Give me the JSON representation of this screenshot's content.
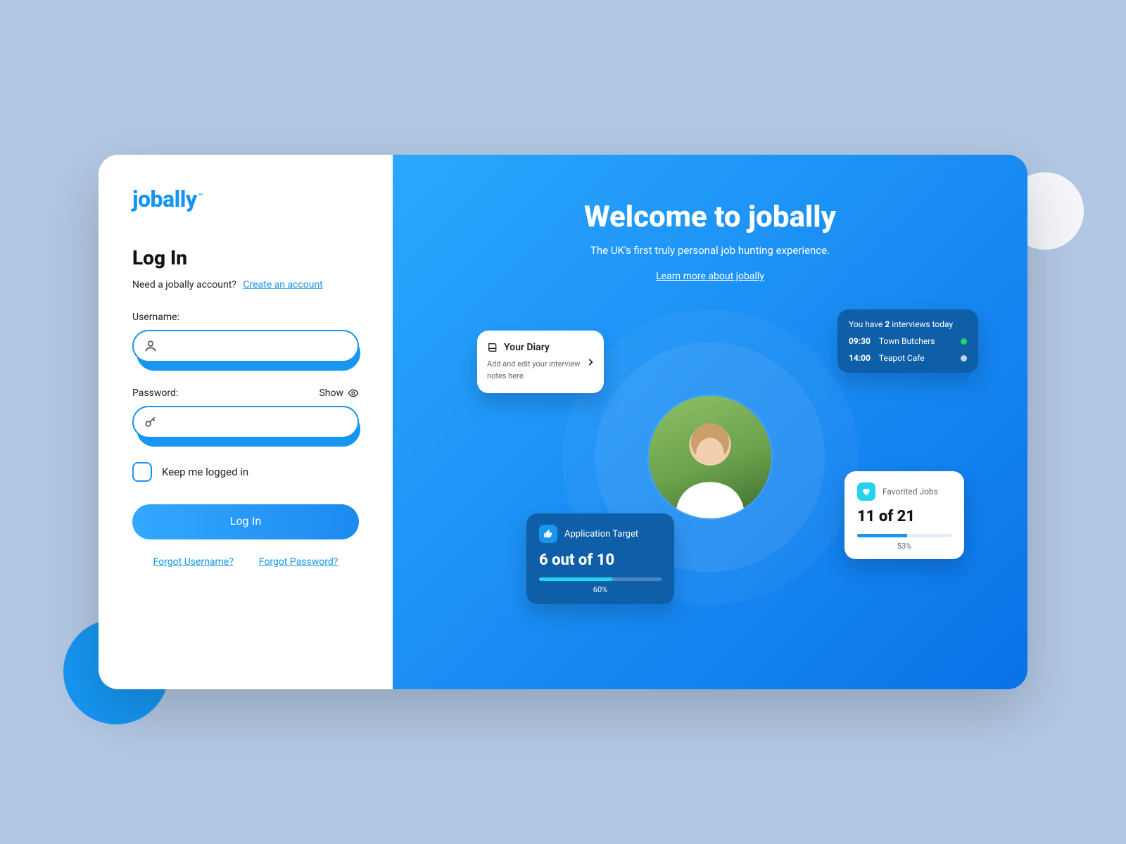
{
  "brand": {
    "name": "jobally",
    "tm": "™"
  },
  "login": {
    "heading": "Log In",
    "need_account_text": "Need a jobally account?",
    "create_account_link": "Create an account",
    "username_label": "Username:",
    "password_label": "Password:",
    "show_label": "Show",
    "remember_label": "Keep me logged in",
    "submit_label": "Log In",
    "forgot_username": "Forgot Username?",
    "forgot_password": "Forgot Password?"
  },
  "hero": {
    "title": "Welcome to jobally",
    "tagline": "The UK's first truly personal job hunting experience.",
    "learn_more": "Learn more about jobally"
  },
  "diary": {
    "title": "Your Diary",
    "subtitle": "Add and edit your interview notes here."
  },
  "interviews": {
    "heading_pre": "You have ",
    "heading_count": "2",
    "heading_post": " interviews today",
    "items": [
      {
        "time": "09:30",
        "label": "Town Butchers",
        "dot": "#26d36a"
      },
      {
        "time": "14:00",
        "label": "Teapot Cafe",
        "dot": "#c3d4e6"
      }
    ]
  },
  "application_target": {
    "title": "Application Target",
    "value": "6 out of 10",
    "percent_label": "60%",
    "percent": 60
  },
  "fav_jobs": {
    "title": "Favorited Jobs",
    "value": "11 of 21",
    "percent_label": "53%",
    "percent": 53
  },
  "colors": {
    "brand": "#1696f1",
    "hero_dark": "#0f5fa8",
    "cyan": "#24d3ee"
  }
}
